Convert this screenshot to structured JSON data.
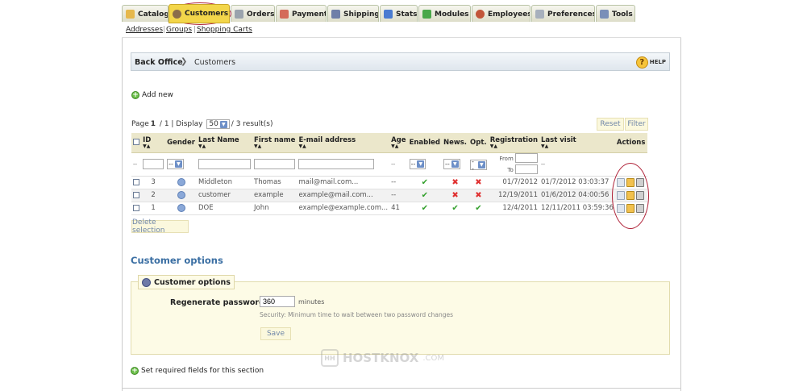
{
  "tabs": [
    {
      "label": "Catalog",
      "icon": "folder-icon",
      "color": "#e6b84d"
    },
    {
      "label": "Customers",
      "icon": "person-icon",
      "color": "#8b6d4a",
      "active": true
    },
    {
      "label": "Orders",
      "icon": "document-icon",
      "color": "#9aa3ad"
    },
    {
      "label": "Payment",
      "icon": "payment-icon",
      "color": "#d46b5a"
    },
    {
      "label": "Shipping",
      "icon": "truck-icon",
      "color": "#6f7fa8"
    },
    {
      "label": "Stats",
      "icon": "chart-icon",
      "color": "#4a7bd1"
    },
    {
      "label": "Modules",
      "icon": "puzzle-icon",
      "color": "#4aa84a"
    },
    {
      "label": "Employees",
      "icon": "employees-icon",
      "color": "#c2553a"
    },
    {
      "label": "Preferences",
      "icon": "preferences-icon",
      "color": "#a7b0bd"
    },
    {
      "label": "Tools",
      "icon": "wrench-icon",
      "color": "#7a8fb8"
    }
  ],
  "subnav": {
    "addresses": "Addresses",
    "groups": "Groups",
    "carts": "Shopping Carts"
  },
  "breadcrumb": {
    "home": "Back Office",
    "current": "Customers",
    "help": "HELP"
  },
  "add_new": "Add new",
  "pager": {
    "prefix": "Page",
    "page": "1",
    "total": " / 1 | Display ",
    "per_page": "50",
    "results": "/ 3 result(s)"
  },
  "buttons": {
    "reset": "Reset",
    "filter": "Filter",
    "delete_selection": "Delete selection",
    "save": "Save"
  },
  "columns": {
    "id": "ID",
    "gender": "Gender",
    "last_name": "Last Name",
    "first_name": "First name",
    "email": "E-mail address",
    "age": "Age",
    "enabled": "Enabled",
    "news": "News.",
    "opt": "Opt.",
    "registration": "Registration",
    "last_visit": "Last visit",
    "actions": "Actions"
  },
  "filters": {
    "placeholder": "--",
    "from": "From",
    "to": "To",
    "dash": "--"
  },
  "customers": [
    {
      "id": "3",
      "last_name": "Middleton",
      "first_name": "Thomas",
      "email": "mail@mail.com...",
      "age": "--",
      "enabled": "✔",
      "news": "✖",
      "opt": "✖",
      "registration": "01/7/2012",
      "last_visit": "01/7/2012 03:03:37"
    },
    {
      "id": "2",
      "last_name": "customer",
      "first_name": "example",
      "email": "example@mail.com...",
      "age": "--",
      "enabled": "✔",
      "news": "✖",
      "opt": "✖",
      "registration": "12/19/2011",
      "last_visit": "01/6/2012 04:00:56"
    },
    {
      "id": "1",
      "last_name": "DOE",
      "first_name": "John",
      "email": "example@example.com...",
      "age": "41",
      "enabled": "✔",
      "news": "✔",
      "opt": "✔",
      "registration": "12/4/2011",
      "last_visit": "12/11/2011 03:59:36"
    }
  ],
  "options": {
    "section_title": "Customer options",
    "legend": "Customer options",
    "regen_label": "Regenerate password:",
    "regen_value": "360",
    "regen_unit": "minutes",
    "regen_hint": "Security: Minimum time to wait between two password changes"
  },
  "required_fields": "Set required fields for this section",
  "watermark": {
    "brand": "HOSTKNOX",
    "suffix": ".COM",
    "logo": "HH"
  },
  "colors": {
    "accent": "#3b6fa3",
    "active_tab": "#f3d64a",
    "annotation": "#b0243a"
  }
}
